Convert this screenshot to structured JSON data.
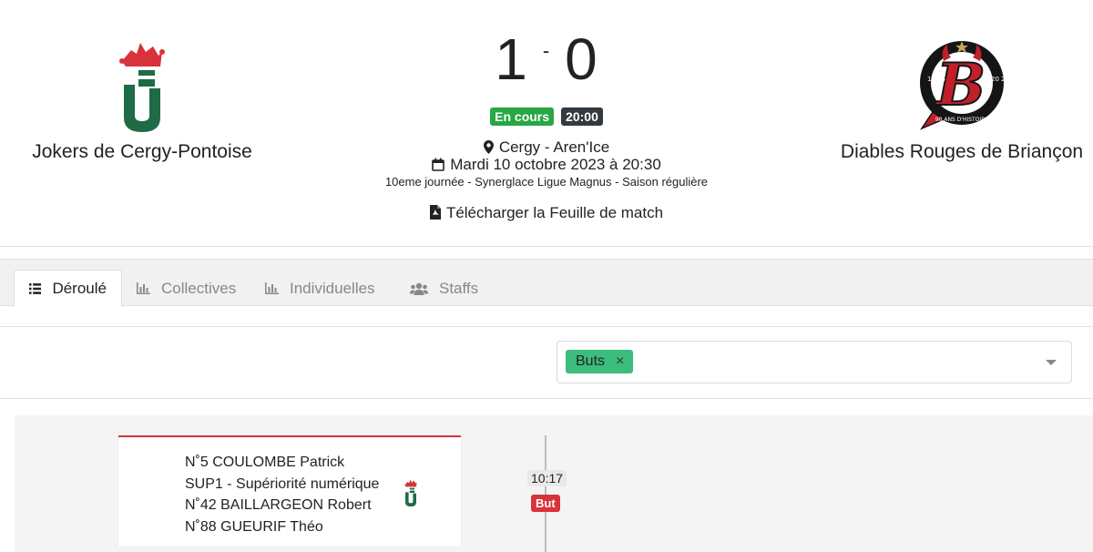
{
  "home": {
    "name": "Jokers de Cergy-Pontoise",
    "logo_icon": "jokers-logo-icon"
  },
  "away": {
    "name": "Diables Rouges de Briançon",
    "logo_icon": "diables-rouges-logo-icon",
    "logo_text_year_left": "19 34",
    "logo_text_year_right": "20 24",
    "logo_text_arc": "90 ANS D'HISTOIRE"
  },
  "score": {
    "home": "1",
    "separator": "-",
    "away": "0"
  },
  "status": {
    "state": "En cours",
    "time": "20:00"
  },
  "match_info": {
    "location": "Cergy - Aren'Ice",
    "date": "Mardi 10 octobre 2023 à 20:30",
    "round": "10eme journée - Synerglace Ligue Magnus - Saison régulière",
    "download_label": "Télécharger la Feuille de match"
  },
  "tabs": [
    {
      "label": "Déroulé",
      "icon": "list-icon",
      "active": true
    },
    {
      "label": "Collectives",
      "icon": "bar-chart-icon",
      "active": false
    },
    {
      "label": "Individuelles",
      "icon": "bar-chart-icon",
      "active": false
    },
    {
      "label": "Staffs",
      "icon": "users-icon",
      "active": false
    }
  ],
  "filter": {
    "chip_label": "Buts",
    "chip_remove": "×"
  },
  "timeline": {
    "events": [
      {
        "time": "10:17",
        "type": "But",
        "team": "home",
        "lines": [
          "N˚5 COULOMBE Patrick",
          "SUP1 - Supériorité numérique",
          "N˚42 BAILLARGEON Robert",
          "N˚88 GUEURIF Théo"
        ]
      }
    ]
  },
  "colors": {
    "live": "#28a745",
    "time_badge": "#343a40",
    "goal": "#d8323a",
    "chip": "#3dbd7d",
    "jokers_green": "#1f6b46",
    "jokers_red": "#d8323a"
  }
}
